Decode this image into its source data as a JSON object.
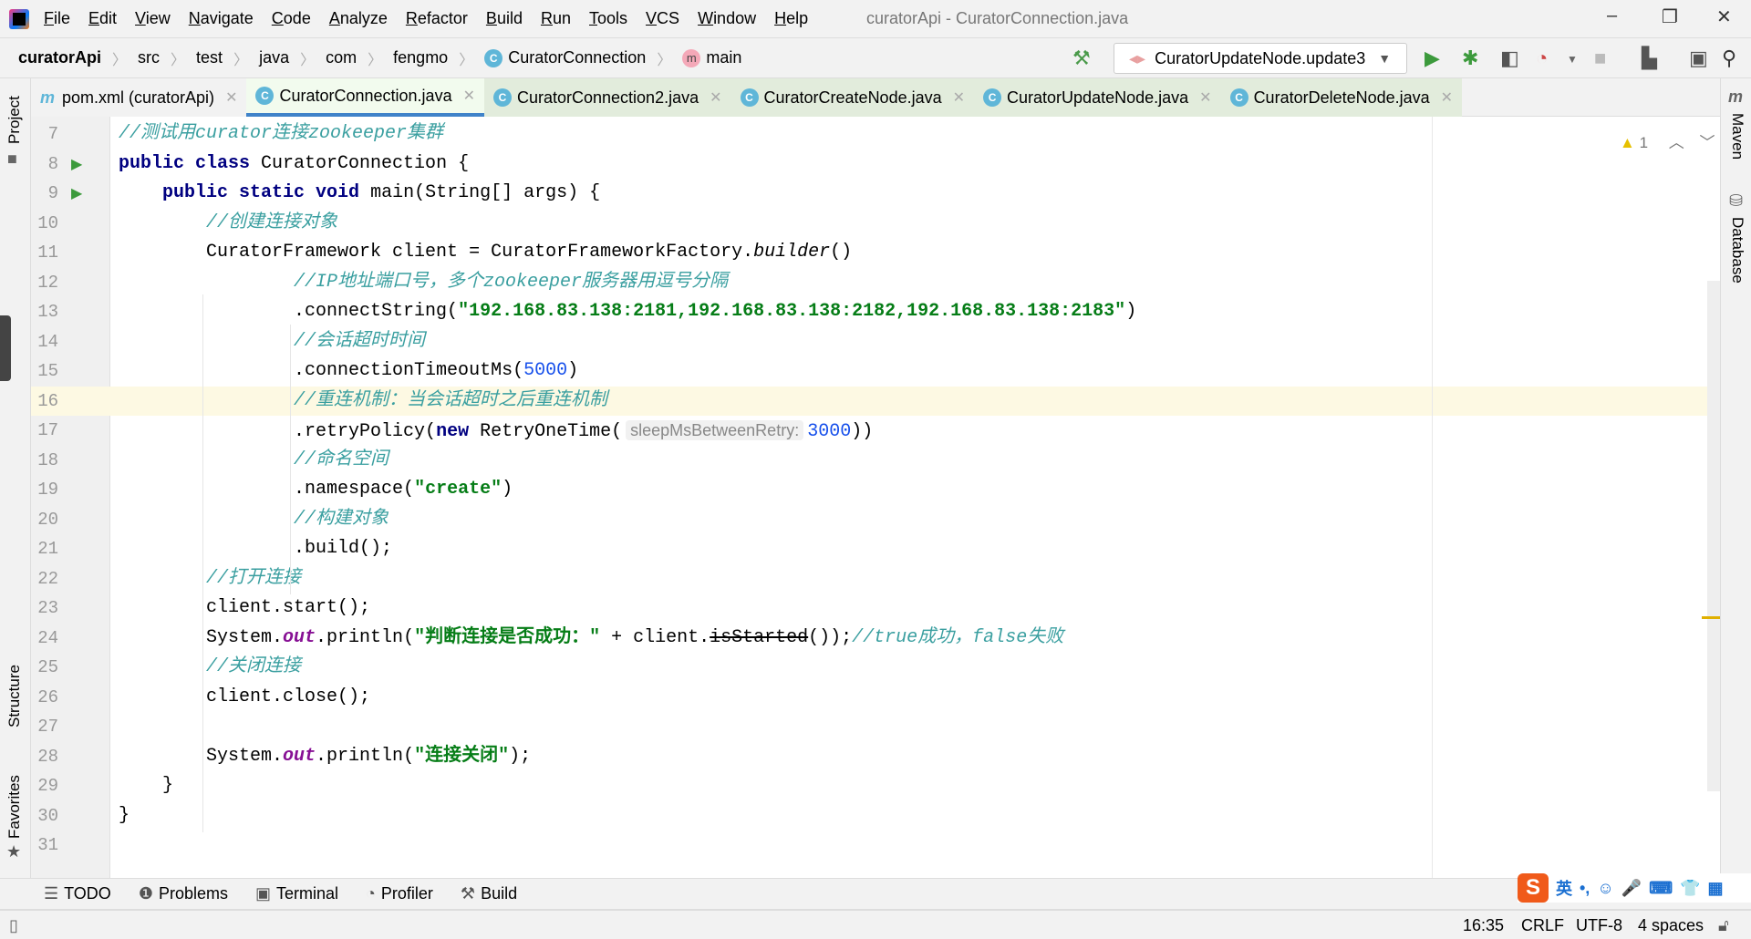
{
  "title_bar": {
    "menu": [
      "File",
      "Edit",
      "View",
      "Navigate",
      "Code",
      "Analyze",
      "Refactor",
      "Build",
      "Run",
      "Tools",
      "VCS",
      "Window",
      "Help"
    ],
    "window_title": "curatorApi - CuratorConnection.java",
    "minimize": "–",
    "restore": "❐",
    "close": "✕"
  },
  "breadcrumb": [
    "curatorApi",
    "src",
    "test",
    "java",
    "com",
    "fengmo",
    "CuratorConnection",
    "main"
  ],
  "toolbar": {
    "run_config": "CuratorUpdateNode.update3"
  },
  "tabs": [
    {
      "label": "pom.xml (curatorApi)",
      "icon": "m"
    },
    {
      "label": "CuratorConnection.java",
      "icon": "C",
      "active": true
    },
    {
      "label": "CuratorConnection2.java",
      "icon": "C"
    },
    {
      "label": "CuratorCreateNode.java",
      "icon": "C"
    },
    {
      "label": "CuratorUpdateNode.java",
      "icon": "C"
    },
    {
      "label": "CuratorDeleteNode.java",
      "icon": "C"
    }
  ],
  "left_strip": {
    "project": "Project",
    "structure": "Structure",
    "favorites": "Favorites"
  },
  "right_strip": {
    "maven": "Maven",
    "database": "Database",
    "maven_icon": "m"
  },
  "inspections": {
    "warnings": "1"
  },
  "highlight_line": 16,
  "code": [
    {
      "n": "7",
      "t": [
        [
          "cmt",
          "//测试用curator连接zookeeper集群"
        ]
      ]
    },
    {
      "n": "8",
      "run": true,
      "t": [
        [
          "kw",
          "public class "
        ],
        [
          "p",
          "CuratorConnection {"
        ]
      ]
    },
    {
      "n": "9",
      "run": true,
      "t": [
        [
          "p",
          "    "
        ],
        [
          "kw",
          "public static void "
        ],
        [
          "p",
          "main(String[] args) {"
        ]
      ]
    },
    {
      "n": "10",
      "t": [
        [
          "p",
          "        "
        ],
        [
          "cmt",
          "//创建连接对象"
        ]
      ]
    },
    {
      "n": "11",
      "t": [
        [
          "p",
          "        CuratorFramework client = CuratorFrameworkFactory."
        ],
        [
          "ital",
          "builder"
        ],
        [
          "p",
          "()"
        ]
      ]
    },
    {
      "n": "12",
      "t": [
        [
          "p",
          "                "
        ],
        [
          "cmt",
          "//IP地址端口号，多个zookeeper服务器用逗号分隔"
        ]
      ]
    },
    {
      "n": "13",
      "t": [
        [
          "p",
          "                .connectString("
        ],
        [
          "str",
          "\"192.168.83.138:2181,192.168.83.138:2182,192.168.83.138:2183\""
        ],
        [
          "p",
          ")"
        ]
      ]
    },
    {
      "n": "14",
      "t": [
        [
          "p",
          "                "
        ],
        [
          "cmt",
          "//会话超时时间"
        ]
      ]
    },
    {
      "n": "15",
      "t": [
        [
          "p",
          "                .connectionTimeoutMs("
        ],
        [
          "num",
          "5000"
        ],
        [
          "p",
          ")"
        ]
      ]
    },
    {
      "n": "16",
      "t": [
        [
          "p",
          "                "
        ],
        [
          "cmt",
          "//重连机制：当会话超时之后重连机制"
        ]
      ]
    },
    {
      "n": "17",
      "t": [
        [
          "p",
          "                .retryPolicy("
        ],
        [
          "kw",
          "new "
        ],
        [
          "p",
          "RetryOneTime("
        ],
        [
          "hint",
          "sleepMsBetweenRetry:"
        ],
        [
          "num",
          "3000"
        ],
        [
          "p",
          "))"
        ]
      ]
    },
    {
      "n": "18",
      "t": [
        [
          "p",
          "                "
        ],
        [
          "cmt",
          "//命名空间"
        ]
      ]
    },
    {
      "n": "19",
      "t": [
        [
          "p",
          "                .namespace("
        ],
        [
          "str",
          "\"create\""
        ],
        [
          "p",
          ")"
        ]
      ]
    },
    {
      "n": "20",
      "t": [
        [
          "p",
          "                "
        ],
        [
          "cmt",
          "//构建对象"
        ]
      ]
    },
    {
      "n": "21",
      "t": [
        [
          "p",
          "                .build();"
        ]
      ]
    },
    {
      "n": "22",
      "t": [
        [
          "p",
          "        "
        ],
        [
          "cmt",
          "//打开连接"
        ]
      ]
    },
    {
      "n": "23",
      "t": [
        [
          "p",
          "        client.start();"
        ]
      ]
    },
    {
      "n": "24",
      "t": [
        [
          "p",
          "        System."
        ],
        [
          "out",
          "out"
        ],
        [
          "p",
          ".println("
        ],
        [
          "str",
          "\"判断连接是否成功：\""
        ],
        [
          "p",
          " + client."
        ],
        [
          "strike",
          "isStarted"
        ],
        [
          "p",
          "());"
        ],
        [
          "cmt",
          "//true成功，false失败"
        ]
      ]
    },
    {
      "n": "25",
      "t": [
        [
          "p",
          "        "
        ],
        [
          "cmt",
          "//关闭连接"
        ]
      ]
    },
    {
      "n": "26",
      "t": [
        [
          "p",
          "        client.close();"
        ]
      ]
    },
    {
      "n": "27",
      "t": []
    },
    {
      "n": "28",
      "t": [
        [
          "p",
          "        System."
        ],
        [
          "out",
          "out"
        ],
        [
          "p",
          ".println("
        ],
        [
          "str",
          "\"连接关闭\""
        ],
        [
          "p",
          ");"
        ]
      ]
    },
    {
      "n": "29",
      "t": [
        [
          "p",
          "    }"
        ]
      ]
    },
    {
      "n": "30",
      "t": [
        [
          "p",
          "}"
        ]
      ]
    },
    {
      "n": "31",
      "t": []
    }
  ],
  "tool_windows": [
    {
      "label": "TODO",
      "icon": "☰"
    },
    {
      "label": "Problems",
      "icon": "❶"
    },
    {
      "label": "Terminal",
      "icon": "▣"
    },
    {
      "label": "Profiler",
      "icon": "◔"
    },
    {
      "label": "Build",
      "icon": "⚒"
    }
  ],
  "status_bar": {
    "position": "16:35",
    "line_sep": "CRLF",
    "encoding": "UTF-8",
    "indent": "4 spaces"
  },
  "ime": {
    "logo": "S",
    "lang": "英",
    "punct": "•,",
    "emoji": "☺",
    "mic": "🎤",
    "keyboard": "⌨",
    "skin": "👕",
    "grid": "▦"
  },
  "colors": {
    "keyword": "#000080",
    "string": "#067d17",
    "number": "#1750eb",
    "comment": "#3a9fa0",
    "active_tab_underline": "#4083c9"
  }
}
